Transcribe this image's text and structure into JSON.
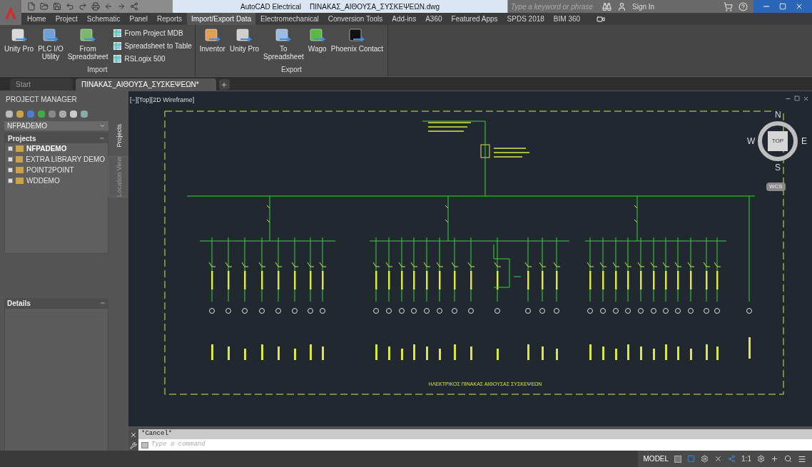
{
  "title_bar": {
    "app": "AutoCAD Electrical",
    "document": "ΠΙΝΑΚΑΣ_ΑΙΘΟΥΣΑ_ΣΥΣΚΕΨΕΩΝ.dwg",
    "search_placeholder": "Type a keyword or phrase",
    "sign_in": "Sign In"
  },
  "ribbon_tabs": [
    {
      "label": "Home",
      "selected": false
    },
    {
      "label": "Project",
      "selected": false
    },
    {
      "label": "Schematic",
      "selected": false
    },
    {
      "label": "Panel",
      "selected": false
    },
    {
      "label": "Reports",
      "selected": false
    },
    {
      "label": "Import/Export Data",
      "selected": true
    },
    {
      "label": "Electromechanical",
      "selected": false
    },
    {
      "label": "Conversion Tools",
      "selected": false
    },
    {
      "label": "Add-ins",
      "selected": false
    },
    {
      "label": "A360",
      "selected": false
    },
    {
      "label": "Featured Apps",
      "selected": false
    },
    {
      "label": "SPDS 2018",
      "selected": false
    },
    {
      "label": "BIM 360",
      "selected": false
    }
  ],
  "ribbon_panels": [
    {
      "title": "Import",
      "buttons": [
        {
          "kind": "large",
          "lines": [
            "Unity Pro"
          ]
        },
        {
          "kind": "large",
          "lines": [
            "PLC I/O",
            "Utility"
          ]
        },
        {
          "kind": "large",
          "lines": [
            "From",
            "Spreadsheet"
          ]
        },
        {
          "kind": "small",
          "lines": [
            "From Project MDB"
          ]
        },
        {
          "kind": "small",
          "lines": [
            "Spreadsheet to Table"
          ]
        },
        {
          "kind": "small",
          "lines": [
            "RSLogix 500"
          ]
        }
      ]
    },
    {
      "title": "Export",
      "buttons": [
        {
          "kind": "large",
          "lines": [
            "Inventor"
          ]
        },
        {
          "kind": "large",
          "lines": [
            "Unity Pro"
          ]
        },
        {
          "kind": "large",
          "lines": [
            "To",
            "Spreadsheet"
          ]
        },
        {
          "kind": "large",
          "lines": [
            "Wago"
          ]
        },
        {
          "kind": "large",
          "lines": [
            "Phoenix Contact"
          ]
        }
      ]
    }
  ],
  "document_tabs": [
    {
      "label": "Start",
      "selected": false
    },
    {
      "label": "ΠΙΝΑΚΑΣ_ΑΙΘΟΥΣΑ_ΣΥΣΚΕΨΕΩΝ*",
      "selected": true
    }
  ],
  "project_manager": {
    "title": "PROJECT MANAGER",
    "project_dropdown": "NFPADEMO",
    "projects_header": "Projects",
    "projects": [
      {
        "name": "NFPADEMO",
        "active": true
      },
      {
        "name": "EXTRA LIBRARY DEMO",
        "active": false
      },
      {
        "name": "POINT2POINT",
        "active": false
      },
      {
        "name": "WDDEMO",
        "active": false
      }
    ],
    "side_tabs": [
      "Projects",
      "Location View"
    ],
    "details_header": "Details"
  },
  "viewport": {
    "label": "[−][Top][2D Wireframe]",
    "drawing_title": "ΗΛΕΚΤΡΙΚΟΣ ΠΙΝΑΚΑΣ ΑΙΘΟΥΣΑΣ ΣΥΣΚΕΨΕΩΝ",
    "viewcube": {
      "north": "N",
      "south": "S",
      "east": "E",
      "west": "W",
      "face": "TOP",
      "ucs": "WCS"
    }
  },
  "command_line": {
    "history": "*Cancel*",
    "placeholder": "Type a command"
  },
  "status_bar": {
    "space": "MODEL",
    "scale": "1:1"
  }
}
